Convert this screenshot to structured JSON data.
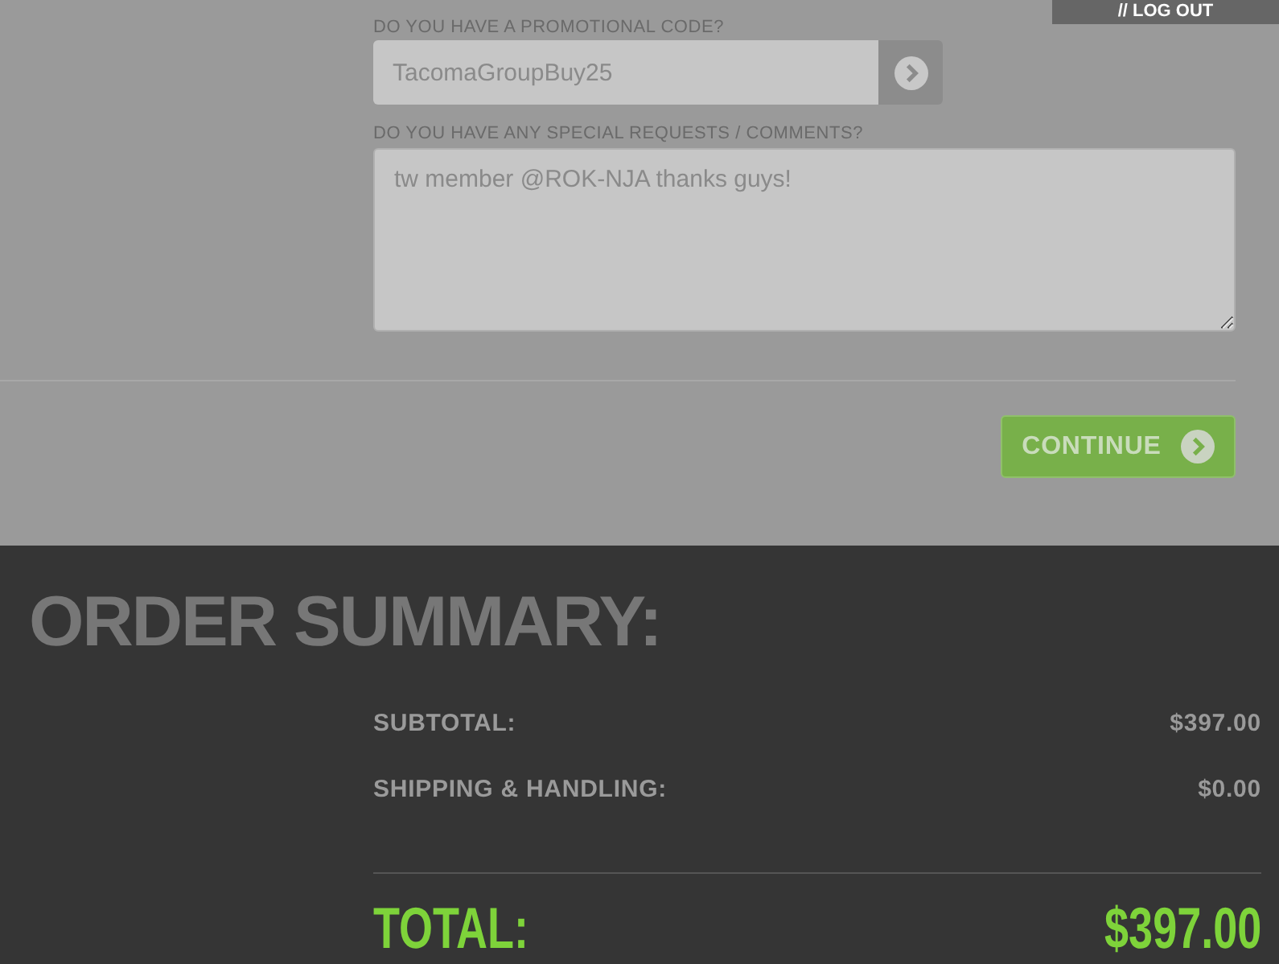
{
  "header": {
    "logout_link": "// LOG OUT"
  },
  "form": {
    "promo_label": "DO YOU HAVE A PROMOTIONAL CODE?",
    "promo_value": "TacomaGroupBuy25",
    "comments_label": "DO YOU HAVE ANY SPECIAL REQUESTS / COMMENTS?",
    "comments_value": "tw member @ROK-NJA thanks guys!",
    "continue_button": "CONTINUE"
  },
  "order_summary": {
    "title": "ORDER SUMMARY:",
    "lines": [
      {
        "label": "SUBTOTAL:",
        "amount": "$397.00"
      },
      {
        "label": "SHIPPING & HANDLING:",
        "amount": "$0.00"
      }
    ],
    "total": {
      "label": "TOTAL:",
      "amount": "$397.00"
    }
  }
}
